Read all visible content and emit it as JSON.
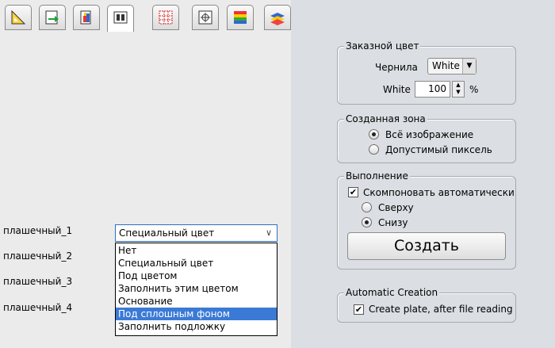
{
  "toolbar": {
    "buttons": [
      {
        "name": "tool-ruler-icon"
      },
      {
        "name": "tool-export-icon"
      },
      {
        "name": "tool-paint-icon"
      },
      {
        "name": "tool-layers-icon",
        "active": true
      },
      {
        "name": "tool-grid-icon"
      },
      {
        "name": "tool-target-icon"
      },
      {
        "name": "tool-color-bars-icon"
      },
      {
        "name": "tool-stack-icon"
      }
    ]
  },
  "layers": {
    "rows": [
      {
        "label": "плашечный_1"
      },
      {
        "label": "плашечный_2"
      },
      {
        "label": "плашечный_3"
      },
      {
        "label": "плашечный_4"
      }
    ],
    "combo_value": "Специальный цвет",
    "options": [
      "Нет",
      "Специальный цвет",
      "Под цветом",
      "Заполнить этим цветом",
      "Основание",
      "Под сплошным фоном",
      "Заполнить подложку"
    ],
    "selected_option": "Под сплошным фоном"
  },
  "custom_color": {
    "legend": "Заказной цвет",
    "ink_label": "Чернила",
    "ink_value": "White",
    "white_label": "White",
    "white_value": "100",
    "unit": "%"
  },
  "zone": {
    "legend": "Созданная зона",
    "options": [
      "Всё изображение",
      "Допустимый пиксель"
    ],
    "selected": "Всё изображение"
  },
  "execution": {
    "legend": "Выполнение",
    "auto_label": "Скомпоновать автоматически",
    "auto_checked": true,
    "options": [
      "Сверху",
      "Снизу"
    ],
    "selected": "Снизу",
    "create_label": "Создать"
  },
  "auto_creation": {
    "legend": "Automatic Creation",
    "label": "Create plate, after file reading",
    "checked": true
  }
}
